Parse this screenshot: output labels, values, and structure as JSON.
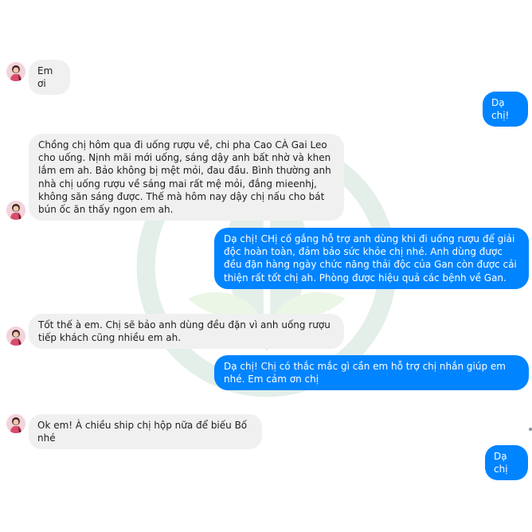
{
  "colors": {
    "outgoing_bubble": "#0084ff",
    "incoming_bubble": "#f1f0f0",
    "incoming_text": "#1c1e21",
    "outgoing_text": "#ffffff"
  },
  "contact": {
    "avatar_icon": "woman-photo-avatar"
  },
  "messages": [
    {
      "side": "in",
      "text": "Em ơi"
    },
    {
      "side": "out",
      "text": "Dạ chị!"
    },
    {
      "side": "in",
      "text": "Chồng chị hôm qua đi uống rượu về, chi pha Cao CÀ Gai Leo cho uống. Nịnh mãi mới uống, sáng dậy anh bất nhờ và khen lắm em ah. Bảo không bị mệt mỏi, đau đầu. Bình thường anh nhà chị uống rượu về sáng mai rất mệ mỏi, đắng mieenhj, không săn sáng được. Thế mà hôm nay dậy chị nấu cho bát bún ốc ăn thấy ngon em ah."
    },
    {
      "side": "out",
      "text": "Dạ chị! CHị cố gắng hỗ trợ anh dùng khi đi uống rượu để giải độc hoàn toàn, đảm bảo sức khỏe chị nhé. Anh dùng được đều đặn hàng ngày chức năng thải độc của Gan còn được cải thiện rất tốt chị ah. Phòng được hiệu quả các bệnh về Gan."
    },
    {
      "side": "in",
      "text": "Tốt thế à em. Chị sẽ bảo anh dùng đều đặn vì anh uống rượu tiếp khách cũng nhiều em ah."
    },
    {
      "side": "out",
      "text": "Dạ chị! Chị có thắc mắc gì cần em hỗ trợ chị nhắn giúp em nhé. Em cảm ơn chị"
    },
    {
      "side": "in",
      "text": "Ok em! À chiều ship chị hộp nữa để biếu Bố nhé"
    },
    {
      "side": "out",
      "text": "Dạ chị"
    }
  ]
}
